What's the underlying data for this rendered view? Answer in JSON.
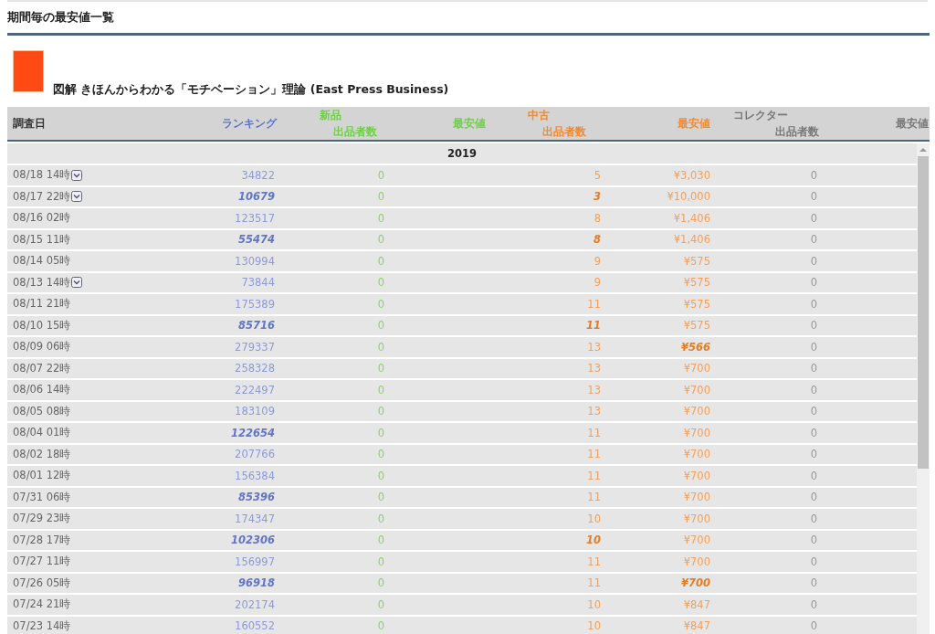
{
  "heading": "期間毎の最安値一覧",
  "product": {
    "title": "図解 きほんからわかる「モチベーション」理論 (East Press Business)"
  },
  "table": {
    "columns": {
      "date": "調査日",
      "ranking": "ランキング",
      "new_group": "新品",
      "new_count": "出品者数",
      "new_price": "最安値",
      "used_group": "中古",
      "used_count": "出品者数",
      "used_price": "最安値",
      "collector_group": "コレクター",
      "collector_count": "出品者数",
      "collector_price": "最安値"
    },
    "year": "2019",
    "rows": [
      {
        "date": "08/18 14時",
        "has_menu": true,
        "ranking": "34822",
        "ranking_highlighted": false,
        "new_count": "0",
        "used_count": "5",
        "used_count_highlighted": false,
        "used_price": "¥3,030",
        "used_price_highlighted": false,
        "collector_count": "0"
      },
      {
        "date": "08/17 22時",
        "has_menu": true,
        "ranking": "10679",
        "ranking_highlighted": true,
        "new_count": "0",
        "used_count": "3",
        "used_count_highlighted": true,
        "used_price": "¥10,000",
        "used_price_highlighted": false,
        "collector_count": "0"
      },
      {
        "date": "08/16 02時",
        "has_menu": false,
        "ranking": "123517",
        "ranking_highlighted": false,
        "new_count": "0",
        "used_count": "8",
        "used_count_highlighted": false,
        "used_price": "¥1,406",
        "used_price_highlighted": false,
        "collector_count": "0"
      },
      {
        "date": "08/15 11時",
        "has_menu": false,
        "ranking": "55474",
        "ranking_highlighted": true,
        "new_count": "0",
        "used_count": "8",
        "used_count_highlighted": true,
        "used_price": "¥1,406",
        "used_price_highlighted": false,
        "collector_count": "0"
      },
      {
        "date": "08/14 05時",
        "has_menu": false,
        "ranking": "130994",
        "ranking_highlighted": false,
        "new_count": "0",
        "used_count": "9",
        "used_count_highlighted": false,
        "used_price": "¥575",
        "used_price_highlighted": false,
        "collector_count": "0"
      },
      {
        "date": "08/13 14時",
        "has_menu": true,
        "ranking": "73844",
        "ranking_highlighted": false,
        "new_count": "0",
        "used_count": "9",
        "used_count_highlighted": false,
        "used_price": "¥575",
        "used_price_highlighted": false,
        "collector_count": "0"
      },
      {
        "date": "08/11 21時",
        "has_menu": false,
        "ranking": "175389",
        "ranking_highlighted": false,
        "new_count": "0",
        "used_count": "11",
        "used_count_highlighted": false,
        "used_price": "¥575",
        "used_price_highlighted": false,
        "collector_count": "0"
      },
      {
        "date": "08/10 15時",
        "has_menu": false,
        "ranking": "85716",
        "ranking_highlighted": true,
        "new_count": "0",
        "used_count": "11",
        "used_count_highlighted": true,
        "used_price": "¥575",
        "used_price_highlighted": false,
        "collector_count": "0"
      },
      {
        "date": "08/09 06時",
        "has_menu": false,
        "ranking": "279337",
        "ranking_highlighted": false,
        "new_count": "0",
        "used_count": "13",
        "used_count_highlighted": false,
        "used_price": "¥566",
        "used_price_highlighted": true,
        "collector_count": "0"
      },
      {
        "date": "08/07 22時",
        "has_menu": false,
        "ranking": "258328",
        "ranking_highlighted": false,
        "new_count": "0",
        "used_count": "13",
        "used_count_highlighted": false,
        "used_price": "¥700",
        "used_price_highlighted": false,
        "collector_count": "0"
      },
      {
        "date": "08/06 14時",
        "has_menu": false,
        "ranking": "222497",
        "ranking_highlighted": false,
        "new_count": "0",
        "used_count": "13",
        "used_count_highlighted": false,
        "used_price": "¥700",
        "used_price_highlighted": false,
        "collector_count": "0"
      },
      {
        "date": "08/05 08時",
        "has_menu": false,
        "ranking": "183109",
        "ranking_highlighted": false,
        "new_count": "0",
        "used_count": "13",
        "used_count_highlighted": false,
        "used_price": "¥700",
        "used_price_highlighted": false,
        "collector_count": "0"
      },
      {
        "date": "08/04 01時",
        "has_menu": false,
        "ranking": "122654",
        "ranking_highlighted": true,
        "new_count": "0",
        "used_count": "11",
        "used_count_highlighted": false,
        "used_price": "¥700",
        "used_price_highlighted": false,
        "collector_count": "0"
      },
      {
        "date": "08/02 18時",
        "has_menu": false,
        "ranking": "207766",
        "ranking_highlighted": false,
        "new_count": "0",
        "used_count": "11",
        "used_count_highlighted": false,
        "used_price": "¥700",
        "used_price_highlighted": false,
        "collector_count": "0"
      },
      {
        "date": "08/01 12時",
        "has_menu": false,
        "ranking": "156384",
        "ranking_highlighted": false,
        "new_count": "0",
        "used_count": "11",
        "used_count_highlighted": false,
        "used_price": "¥700",
        "used_price_highlighted": false,
        "collector_count": "0"
      },
      {
        "date": "07/31 06時",
        "has_menu": false,
        "ranking": "85396",
        "ranking_highlighted": true,
        "new_count": "0",
        "used_count": "11",
        "used_count_highlighted": false,
        "used_price": "¥700",
        "used_price_highlighted": false,
        "collector_count": "0"
      },
      {
        "date": "07/29 23時",
        "has_menu": false,
        "ranking": "174347",
        "ranking_highlighted": false,
        "new_count": "0",
        "used_count": "10",
        "used_count_highlighted": false,
        "used_price": "¥700",
        "used_price_highlighted": false,
        "collector_count": "0"
      },
      {
        "date": "07/28 17時",
        "has_menu": false,
        "ranking": "102306",
        "ranking_highlighted": true,
        "new_count": "0",
        "used_count": "10",
        "used_count_highlighted": true,
        "used_price": "¥700",
        "used_price_highlighted": false,
        "collector_count": "0"
      },
      {
        "date": "07/27 11時",
        "has_menu": false,
        "ranking": "156997",
        "ranking_highlighted": false,
        "new_count": "0",
        "used_count": "11",
        "used_count_highlighted": false,
        "used_price": "¥700",
        "used_price_highlighted": false,
        "collector_count": "0"
      },
      {
        "date": "07/26 05時",
        "has_menu": false,
        "ranking": "96918",
        "ranking_highlighted": true,
        "new_count": "0",
        "used_count": "11",
        "used_count_highlighted": false,
        "used_price": "¥700",
        "used_price_highlighted": true,
        "collector_count": "0"
      },
      {
        "date": "07/24 21時",
        "has_menu": false,
        "ranking": "202174",
        "ranking_highlighted": false,
        "new_count": "0",
        "used_count": "10",
        "used_count_highlighted": false,
        "used_price": "¥847",
        "used_price_highlighted": false,
        "collector_count": "0"
      },
      {
        "date": "07/23 14時",
        "has_menu": false,
        "ranking": "160552",
        "ranking_highlighted": false,
        "new_count": "0",
        "used_count": "10",
        "used_count_highlighted": false,
        "used_price": "¥847",
        "used_price_highlighted": false,
        "collector_count": "0"
      }
    ]
  }
}
